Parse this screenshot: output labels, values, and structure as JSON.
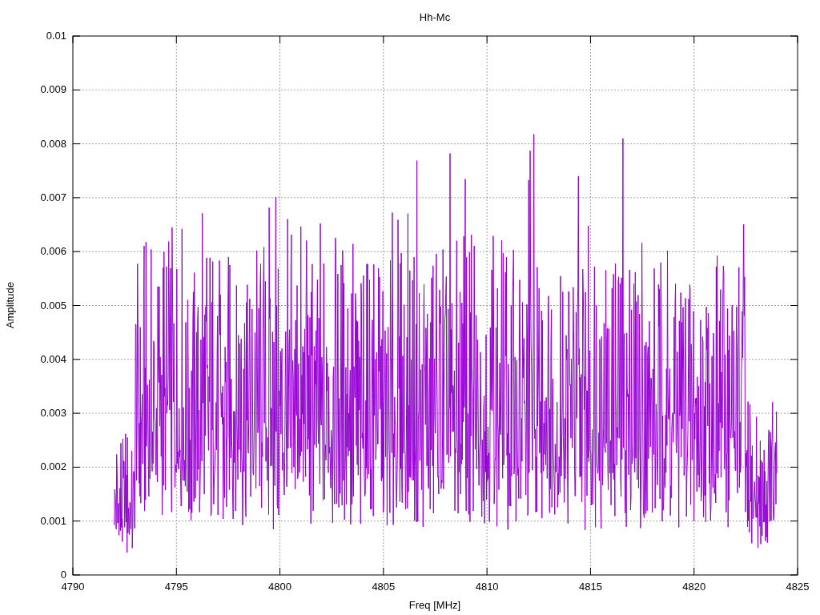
{
  "chart": {
    "chart_data": {
      "type": "line",
      "title": "Hh-Mc",
      "xlabel": "Freq [MHz]",
      "ylabel": "Amplitude",
      "grid": true,
      "xlim": [
        4790,
        4825
      ],
      "ylim": [
        0,
        0.01
      ],
      "xticks": [
        4790,
        4795,
        4800,
        4805,
        4810,
        4815,
        4820,
        4825
      ],
      "yticks": [
        0,
        0.001,
        0.002,
        0.003,
        0.004,
        0.005,
        0.006,
        0.007,
        0.008,
        0.009,
        0.01
      ]
    }
  }
}
